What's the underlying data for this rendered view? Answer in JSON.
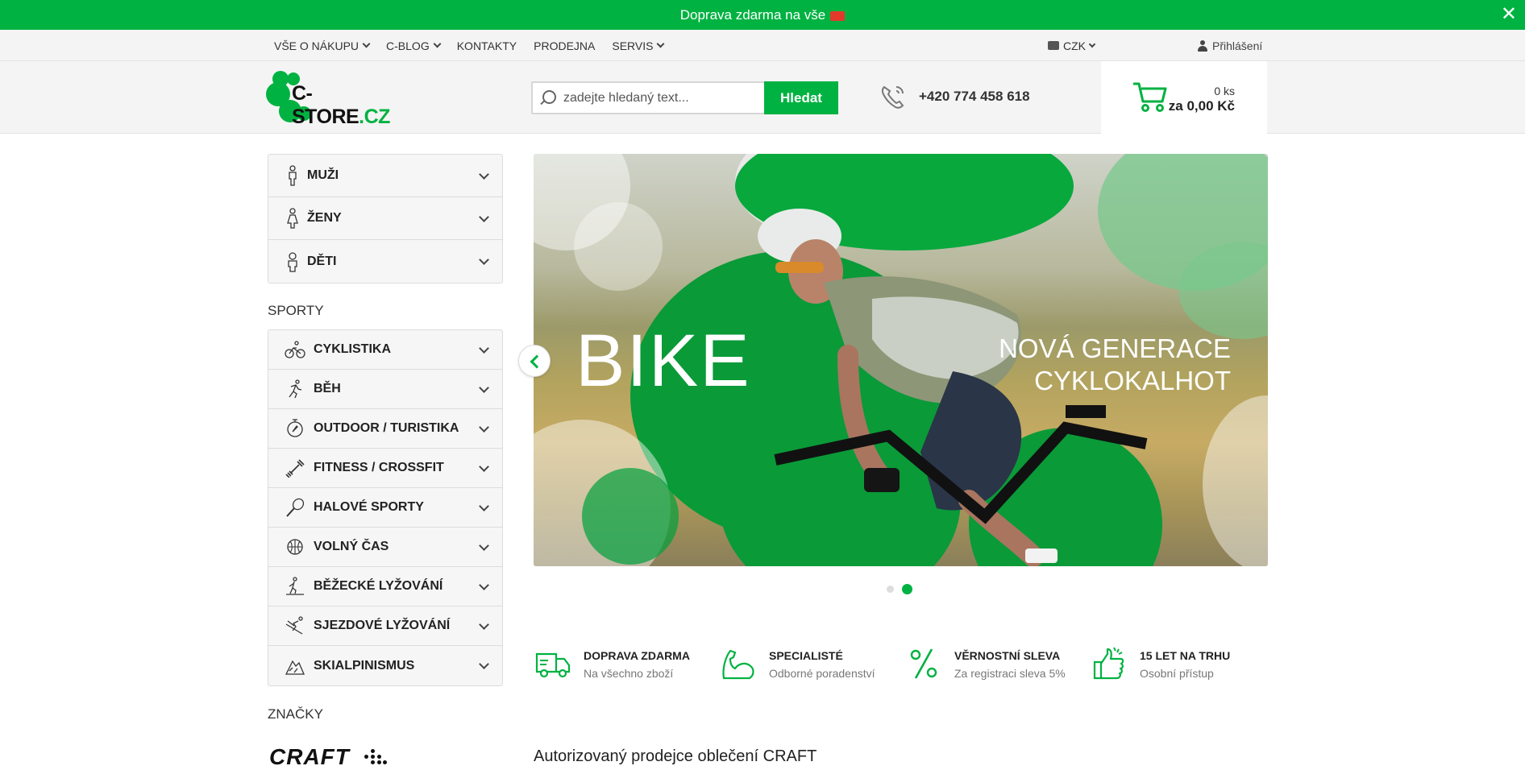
{
  "topbar": {
    "text": "Doprava zdarma na vše",
    "close": "✕"
  },
  "util_nav": {
    "items": [
      {
        "label": "VŠE O NÁKUPU",
        "dropdown": true
      },
      {
        "label": "C-BLOG",
        "dropdown": true
      },
      {
        "label": "KONTAKTY",
        "dropdown": false
      },
      {
        "label": "PRODEJNA",
        "dropdown": false
      },
      {
        "label": "SERVIS",
        "dropdown": true
      }
    ],
    "currency": "CZK",
    "login": "Přihlášení"
  },
  "header": {
    "logo_main": "C-STORE",
    "logo_tld": ".CZ",
    "search_placeholder": "zadejte hledaný text...",
    "search_button": "Hledat",
    "phone": "+420 774 458 618",
    "cart_qty": "0 ks",
    "cart_total": "za 0,00 Kč"
  },
  "sidebar": {
    "gender_items": [
      {
        "label": "MUŽI",
        "icon": "man-icon"
      },
      {
        "label": "ŽENY",
        "icon": "woman-icon"
      },
      {
        "label": "DĚTI",
        "icon": "child-icon"
      }
    ],
    "sports_title": "SPORTY",
    "sports_items": [
      {
        "label": "CYKLISTIKA",
        "icon": "bicycle-icon"
      },
      {
        "label": "BĚH",
        "icon": "runner-icon"
      },
      {
        "label": "OUTDOOR / TURISTIKA",
        "icon": "compass-icon"
      },
      {
        "label": "FITNESS / CROSSFIT",
        "icon": "dumbbell-icon"
      },
      {
        "label": "HALOVÉ SPORTY",
        "icon": "racket-icon"
      },
      {
        "label": "VOLNÝ ČAS",
        "icon": "ball-icon"
      },
      {
        "label": "BĚŽECKÉ LYŽOVÁNÍ",
        "icon": "cross-country-ski-icon"
      },
      {
        "label": "SJEZDOVÉ LYŽOVÁNÍ",
        "icon": "downhill-ski-icon"
      },
      {
        "label": "SKIALPINISMUS",
        "icon": "ski-touring-icon"
      }
    ],
    "brands_title": "ZNAČKY",
    "brand_logo": "CRAFT"
  },
  "banner": {
    "title": "BIKE",
    "subtitle_line1": "NOVÁ GENERACE",
    "subtitle_line2": "CYKLOKALHOT",
    "active_slide": 2,
    "slide_count": 2
  },
  "features": [
    {
      "title": "DOPRAVA ZDARMA",
      "subtitle": "Na všechno zboží",
      "icon": "truck-icon"
    },
    {
      "title": "SPECIALISTÉ",
      "subtitle": "Odborné poradenství",
      "icon": "muscle-icon"
    },
    {
      "title": "VĚRNOSTNÍ SLEVA",
      "subtitle": "Za registraci sleva 5%",
      "icon": "percent-icon"
    },
    {
      "title": "15 LET NA TRHU",
      "subtitle": "Osobní přístup",
      "icon": "thumbs-up-icon"
    }
  ],
  "main_title": "Autorizovaný prodejce oblečení CRAFT",
  "colors": {
    "brand_green": "#00b241",
    "background_gray": "#f4f4f4"
  }
}
